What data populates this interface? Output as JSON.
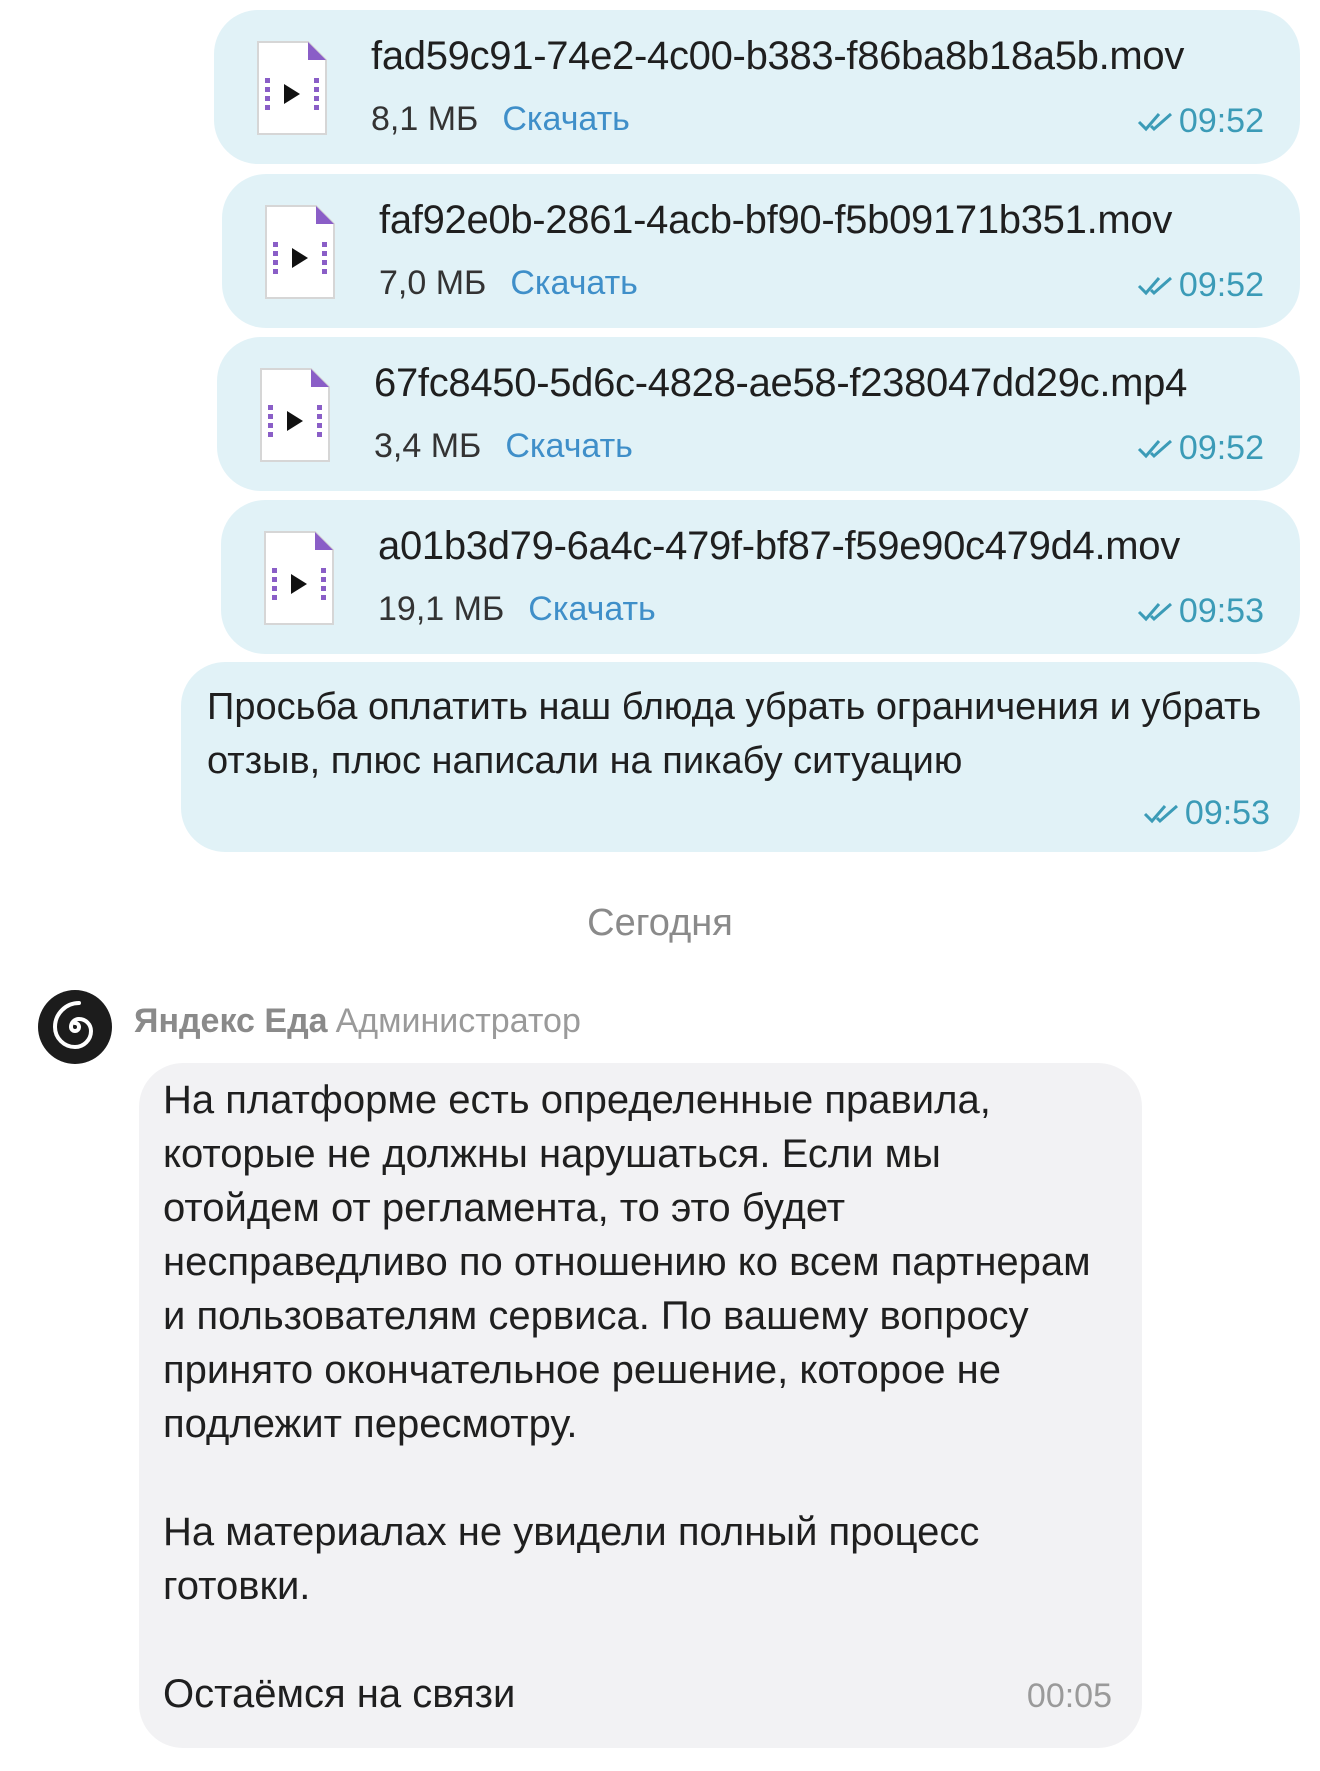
{
  "colors": {
    "outgoing_bubble": "#e1f2f7",
    "incoming_bubble": "#f2f2f4",
    "link": "#3f8fc9",
    "time_read": "#3b9bb7",
    "file_icon_accent": "#8a5ec7"
  },
  "files": [
    {
      "name": "fad59c91-74e2-4c00-b383-f86ba8b18a5b.mov",
      "size": "8,1 МБ",
      "download_label": "Скачать",
      "time": "09:52",
      "icon": "video-file-icon",
      "status_icon": "double-check-icon"
    },
    {
      "name": "faf92e0b-2861-4acb-bf90-f5b09171b351.mov",
      "size": "7,0 МБ",
      "download_label": "Скачать",
      "time": "09:52",
      "icon": "video-file-icon",
      "status_icon": "double-check-icon"
    },
    {
      "name": "67fc8450-5d6c-4828-ae58-f238047dd29c.mp4",
      "size": "3,4 МБ",
      "download_label": "Скачать",
      "time": "09:52",
      "icon": "video-file-icon",
      "status_icon": "double-check-icon"
    },
    {
      "name": "a01b3d79-6a4c-479f-bf87-f59e90c479d4.mov",
      "size": "19,1 МБ",
      "download_label": "Скачать",
      "time": "09:53",
      "icon": "video-file-icon",
      "status_icon": "double-check-icon"
    }
  ],
  "outgoing_message": {
    "text": "Просьба оплатить наш блюда убрать ограничения и убрать отзыв, плюс написали на пикабу ситуацию",
    "time": "09:53",
    "status_icon": "double-check-icon"
  },
  "date_separator": "Сегодня",
  "incoming_message": {
    "sender_name": "Яндекс Еда",
    "sender_role": "Администратор",
    "avatar_icon": "spiral-logo-icon",
    "paragraphs": [
      "На платформе есть определенные правила, которые не должны нарушаться. Если мы отойдем от регламента, то это будет несправедливо по отношению ко всем партнерам и пользователям сервиса. По вашему вопросу принято окончательное решение, которое не подлежит пересмотру.",
      "На материалах не увидели полный процесс готовки.",
      "Остаёмся на связи"
    ],
    "time": "00:05"
  }
}
